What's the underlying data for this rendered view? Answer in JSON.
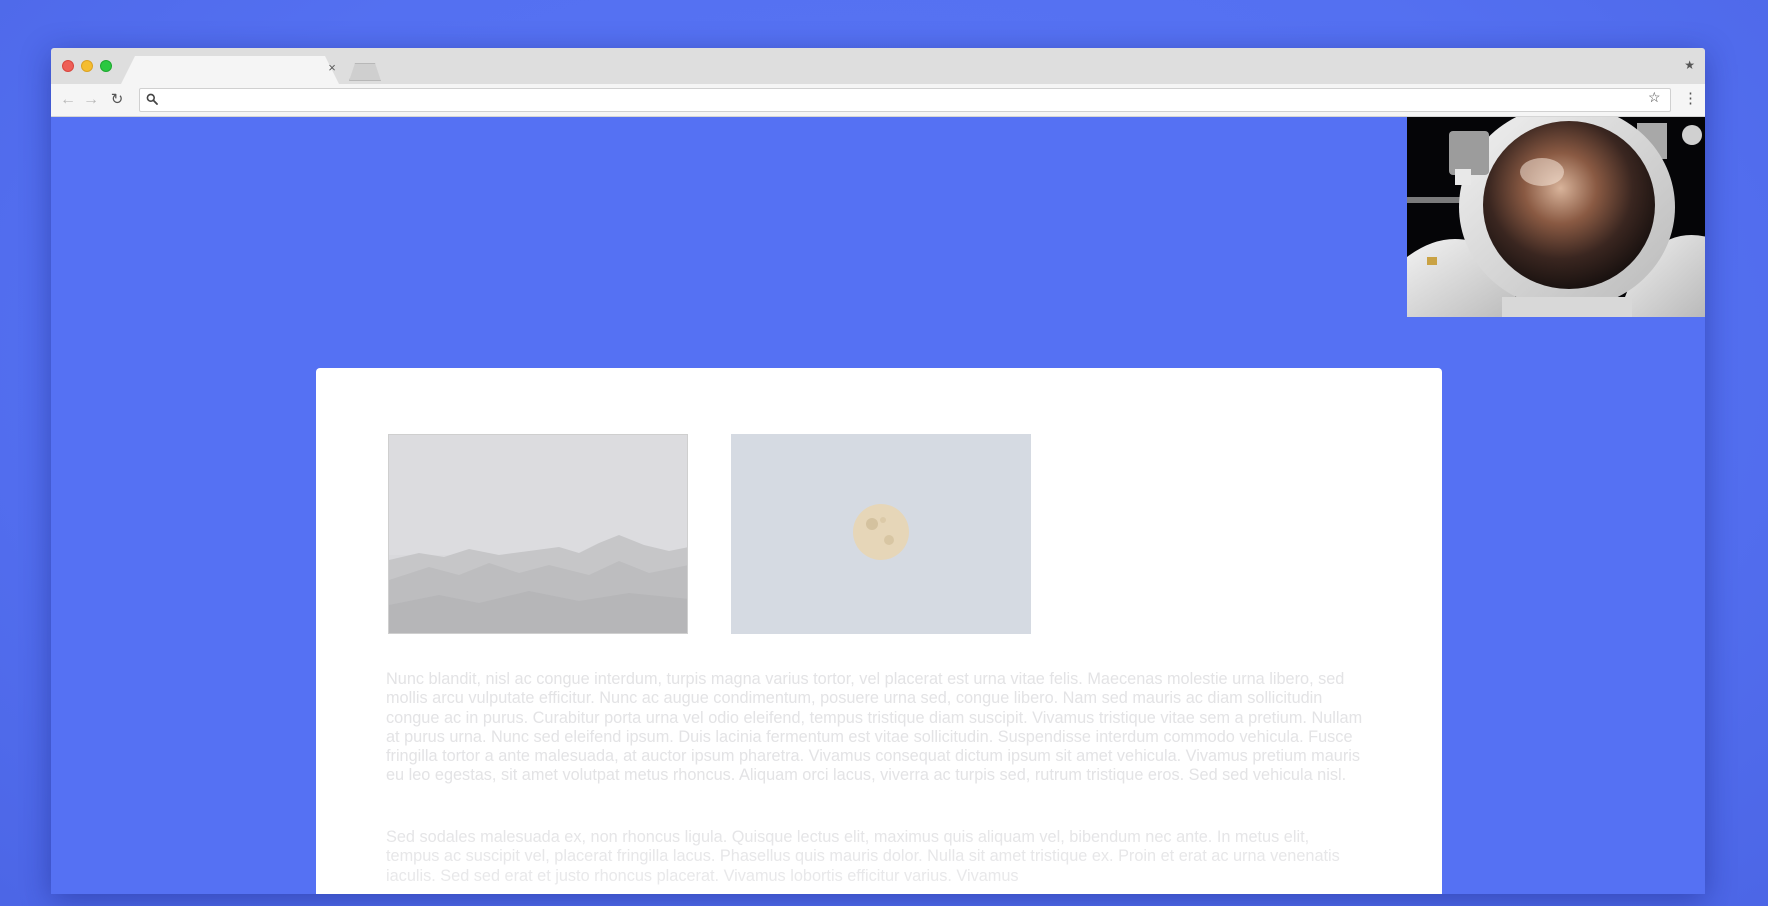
{
  "window": {
    "traffic_lights": [
      "close",
      "minimize",
      "zoom"
    ],
    "tab": {
      "title": "",
      "close_glyph": "×"
    },
    "colors": {
      "close": "#ee5f57",
      "minimize": "#f5bd2e",
      "zoom": "#2bc840"
    }
  },
  "toolbar": {
    "back_icon": "←",
    "forward_icon": "→",
    "reload_icon": "↻",
    "address": {
      "value": "",
      "placeholder": ""
    },
    "bookmark_icon": "☆",
    "menu_icon": "⋮",
    "strip_star_icon": "★"
  },
  "page": {
    "background": "#5571f3",
    "pip_video": {
      "subject": "astronaut-selfie"
    },
    "images": [
      {
        "subject": "mountains"
      },
      {
        "subject": "moon"
      }
    ],
    "paragraphs": [
      "Nunc blandit, nisl ac congue interdum, turpis magna varius tortor, vel placerat est urna vitae felis. Maecenas molestie urna libero, sed mollis arcu vulputate efficitur. Nunc ac augue condimentum, posuere urna sed, congue libero. Nam sed mauris ac diam sollicitudin congue ac in purus. Curabitur porta urna vel odio eleifend, tempus tristique diam suscipit. Vivamus tristique vitae sem a pretium. Nullam at purus urna. Nunc sed eleifend ipsum. Duis lacinia fermentum est vitae sollicitudin. Suspendisse interdum commodo vehicula. Fusce fringilla tortor a ante malesuada, at auctor ipsum pharetra. Vivamus consequat dictum ipsum sit amet vehicula. Vivamus pretium mauris eu leo egestas, sit amet volutpat metus rhoncus. Aliquam orci lacus, viverra ac turpis sed, rutrum tristique eros. Sed sed vehicula nisl.",
      "Sed sodales malesuada ex, non rhoncus ligula. Quisque lectus elit, maximus quis aliquam vel, bibendum nec ante. In metus elit, tempus ac suscipit vel, placerat fringilla lacus. Phasellus quis mauris dolor. Nulla sit amet tristique ex. Proin et erat ac urna venenatis iaculis. Sed sed erat et justo rhoncus placerat. Vivamus lobortis efficitur varius. Vivamus"
    ]
  }
}
